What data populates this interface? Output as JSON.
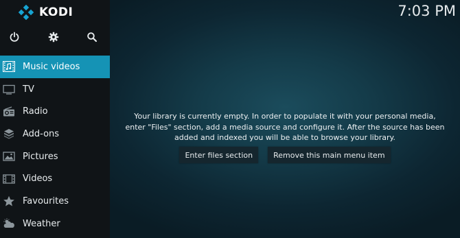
{
  "brand": {
    "name": "KODI",
    "accent": "#1593b5"
  },
  "top_icons": [
    {
      "name": "power-icon"
    },
    {
      "name": "settings-icon"
    },
    {
      "name": "search-icon"
    }
  ],
  "nav": {
    "items": [
      {
        "label": "Music videos",
        "icon": "music-video-icon",
        "active": true
      },
      {
        "label": "TV",
        "icon": "tv-icon",
        "active": false
      },
      {
        "label": "Radio",
        "icon": "radio-icon",
        "active": false
      },
      {
        "label": "Add-ons",
        "icon": "addons-icon",
        "active": false
      },
      {
        "label": "Pictures",
        "icon": "pictures-icon",
        "active": false
      },
      {
        "label": "Videos",
        "icon": "videos-icon",
        "active": false
      },
      {
        "label": "Favourites",
        "icon": "star-icon",
        "active": false
      },
      {
        "label": "Weather",
        "icon": "weather-icon",
        "active": false
      }
    ]
  },
  "clock": {
    "time": "7:03 PM"
  },
  "message": {
    "line1": "Your library is currently empty. In order to populate it with your personal media,",
    "line2": "enter \"Files\" section, add a media source and configure it. After the source has been",
    "line3": "added and indexed you will be able to browse your library."
  },
  "actions": {
    "enter_files": "Enter files section",
    "remove_item": "Remove this main menu item"
  }
}
